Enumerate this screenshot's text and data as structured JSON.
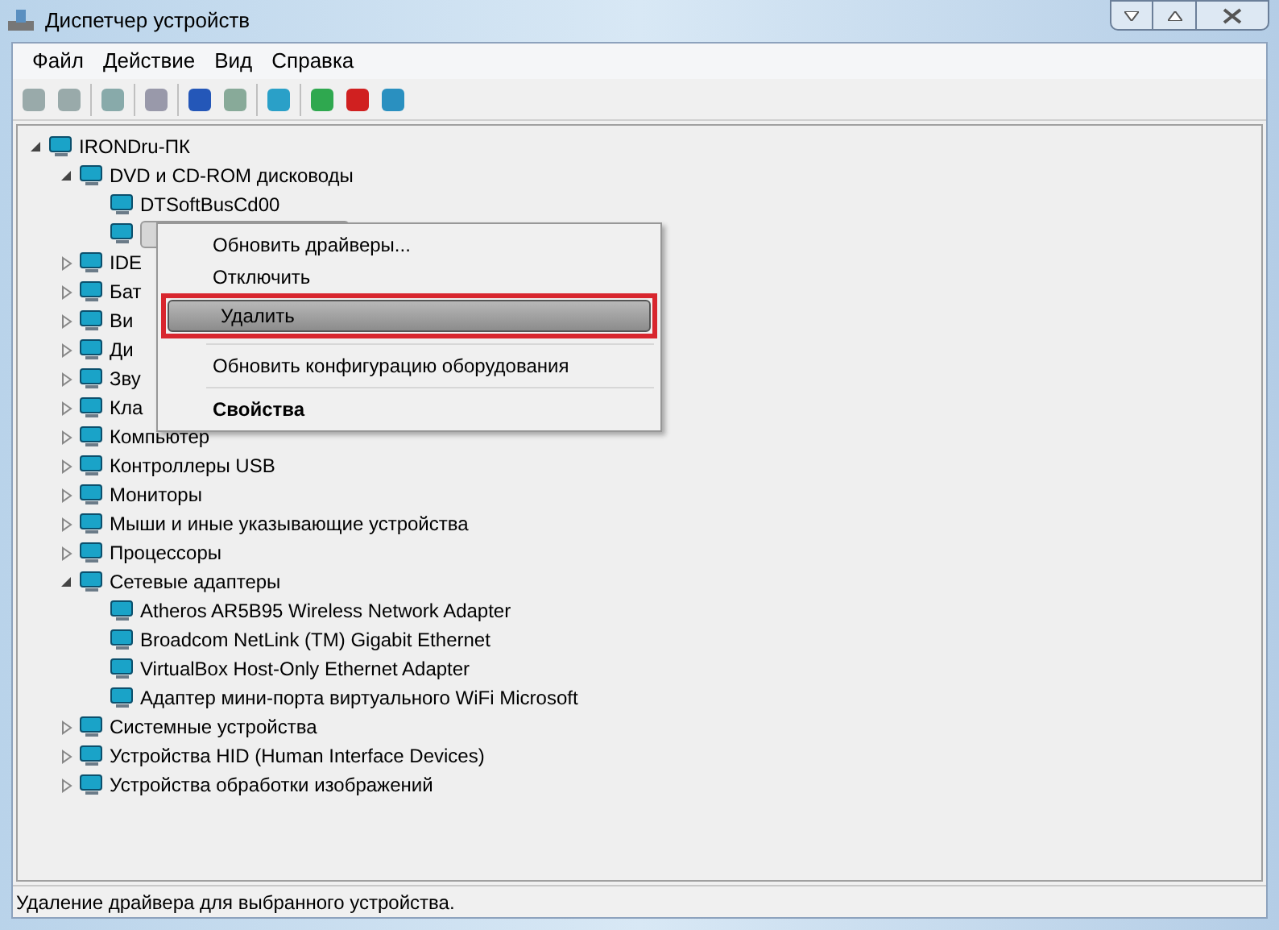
{
  "window": {
    "title": "Диспетчер устройств"
  },
  "menu_bar": [
    "Файл",
    "Действие",
    "Вид",
    "Справка"
  ],
  "tree": [
    {
      "label": "IRONDru-ПК",
      "expanded": true,
      "children": [
        {
          "label": "DVD и CD-ROM дисководы",
          "expanded": true,
          "children": [
            {
              "label": "DTSoftBusCd00",
              "selected": false
            },
            {
              "selected": true
            }
          ]
        },
        {
          "label": "IDE",
          "expanded": false
        },
        {
          "label": "Бат",
          "expanded": false
        },
        {
          "label": "Ви",
          "expanded": false
        },
        {
          "label": "Ди",
          "expanded": false
        },
        {
          "label": "Зву",
          "expanded": false
        },
        {
          "label": "Кла",
          "expanded": false
        },
        {
          "label": "Компьютер",
          "expanded": false
        },
        {
          "label": "Контроллеры USB",
          "expanded": false
        },
        {
          "label": "Мониторы",
          "expanded": false
        },
        {
          "label": "Мыши и иные указывающие устройства",
          "expanded": false
        },
        {
          "label": "Процессоры",
          "expanded": false
        },
        {
          "label": "Сетевые адаптеры",
          "expanded": true,
          "children": [
            {
              "label": "Atheros AR5B95 Wireless Network Adapter",
              "selected": false
            },
            {
              "label": "Broadcom NetLink (TM) Gigabit Ethernet",
              "selected": false
            },
            {
              "label": "VirtualBox Host-Only Ethernet Adapter",
              "selected": false
            },
            {
              "label": "Адаптер мини-порта виртуального WiFi Microsoft",
              "selected": false
            }
          ]
        },
        {
          "label": "Системные устройства",
          "expanded": false
        },
        {
          "label": "Устройства HID (Human Interface Devices)",
          "expanded": false
        },
        {
          "label": "Устройства обработки изображений",
          "expanded": false
        }
      ]
    }
  ],
  "context_menu": [
    {
      "label": "Обновить драйверы...",
      "selected": false,
      "bold": false,
      "highlighted": false
    },
    {
      "label": "Отключить",
      "selected": false,
      "bold": false,
      "highlighted": false
    },
    {
      "label": "Удалить",
      "selected": true,
      "bold": false,
      "highlighted": true
    },
    {
      "kind": "separator"
    },
    {
      "label": "Обновить конфигурацию оборудования",
      "selected": false,
      "bold": false,
      "highlighted": false
    },
    {
      "kind": "separator"
    },
    {
      "label": "Свойства",
      "selected": false,
      "bold": true,
      "highlighted": false
    }
  ],
  "status_bar": "Удаление драйвера для выбранного устройства."
}
